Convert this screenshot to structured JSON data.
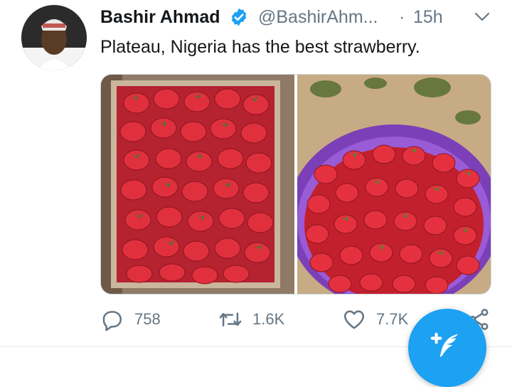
{
  "tweet": {
    "author_name": "Bashir Ahmad",
    "handle": "@BashirAhm...",
    "separator": "·",
    "time": "15h",
    "text": "Plateau, Nigeria has the best strawberry."
  },
  "actions": {
    "replies": "758",
    "retweets": "1.6K",
    "likes": "7.7K"
  },
  "colors": {
    "accent": "#1da1f2",
    "secondary_text": "#657786",
    "verified": "#1da1f2"
  },
  "icons": {
    "verified": "verified-badge-icon",
    "caret": "chevron-down-icon",
    "reply": "reply-icon",
    "retweet": "retweet-icon",
    "like": "heart-icon",
    "share": "share-icon",
    "compose": "compose-tweet-icon"
  }
}
